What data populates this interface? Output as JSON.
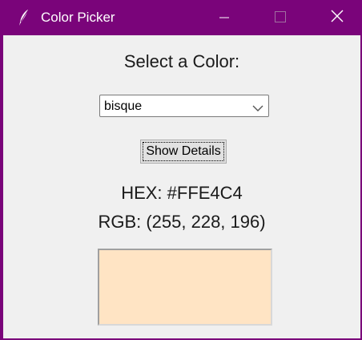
{
  "window": {
    "title": "Color Picker",
    "app_icon": "feather-icon",
    "titlebar_color": "#7a047a"
  },
  "controls": {
    "minimize": "minimize-icon",
    "maximize": "maximize-icon",
    "close": "close-icon"
  },
  "main": {
    "heading": "Select a Color:",
    "color_select": {
      "selected": "bisque",
      "arrow_icon": "chevron-down-icon"
    },
    "details_button_label": "Show Details",
    "hex_text": "HEX: #FFE4C4",
    "rgb_text": "RGB: (255, 228, 196)",
    "swatch_color": "#FFE4C4"
  }
}
